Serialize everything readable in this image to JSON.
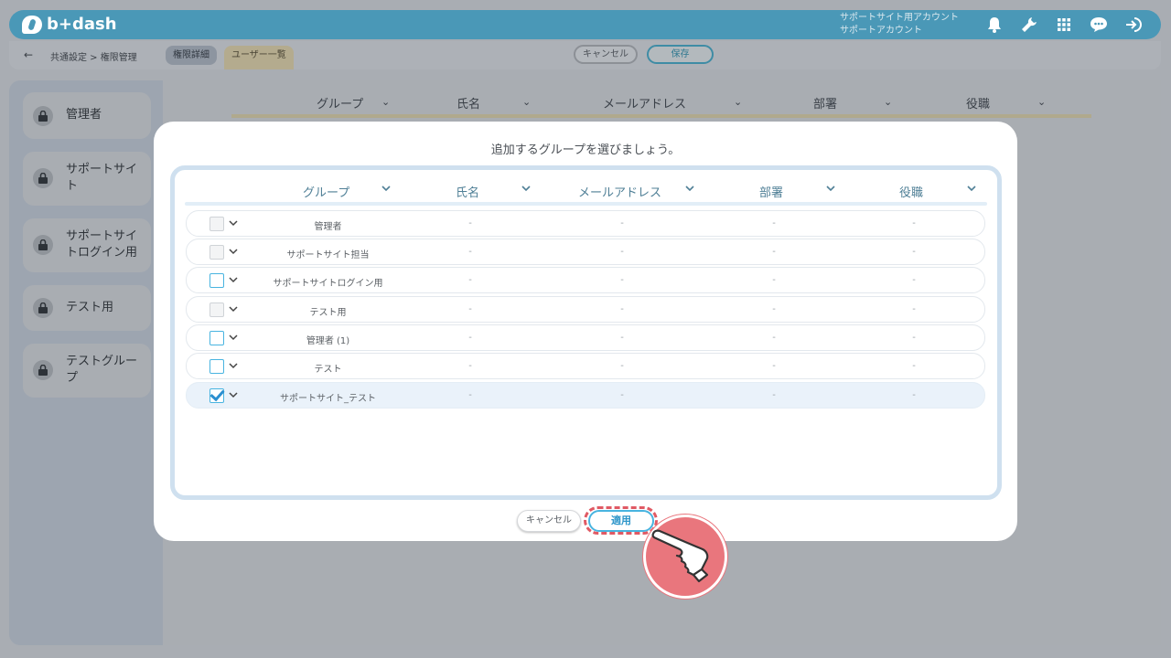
{
  "header": {
    "logo_text": "b+dash",
    "account_line1": "サポートサイト用アカウント",
    "account_line2": "サポートアカウント",
    "icons": [
      "bell-icon",
      "wrench-icon",
      "grid-icon",
      "chat-icon",
      "logout-icon"
    ]
  },
  "subheader": {
    "back_icon": "back-arrow-icon",
    "breadcrumb": "共通設定 > 権限管理",
    "tab_detail": "権限詳細",
    "tab_users": "ユーザー一覧",
    "cancel_label": "キャンセル",
    "save_label": "保存"
  },
  "sidebar": {
    "items": [
      {
        "label": "管理者"
      },
      {
        "label": "サポートサイト"
      },
      {
        "label": "サポートサイトログイン用"
      },
      {
        "label": "テスト用"
      },
      {
        "label": "テストグループ"
      }
    ]
  },
  "background_table": {
    "columns": [
      "グループ",
      "氏名",
      "メールアドレス",
      "部署",
      "役職"
    ]
  },
  "modal": {
    "title": "追加するグループを選びましょう。",
    "columns": [
      "グループ",
      "氏名",
      "メールアドレス",
      "部署",
      "役職"
    ],
    "rows": [
      {
        "group": "管理者",
        "name": "-",
        "email": "-",
        "dept": "-",
        "role": "-",
        "state": "disabled"
      },
      {
        "group": "サポートサイト担当",
        "name": "-",
        "email": "-",
        "dept": "-",
        "role": "-",
        "state": "disabled"
      },
      {
        "group": "サポートサイトログイン用",
        "name": "-",
        "email": "-",
        "dept": "-",
        "role": "-",
        "state": "unchecked"
      },
      {
        "group": "テスト用",
        "name": "-",
        "email": "-",
        "dept": "-",
        "role": "-",
        "state": "disabled"
      },
      {
        "group": "管理者 (1)",
        "name": "-",
        "email": "-",
        "dept": "-",
        "role": "-",
        "state": "unchecked"
      },
      {
        "group": "テスト",
        "name": "-",
        "email": "-",
        "dept": "-",
        "role": "-",
        "state": "unchecked"
      },
      {
        "group": "サポートサイト_テスト",
        "name": "-",
        "email": "-",
        "dept": "-",
        "role": "-",
        "state": "checked"
      }
    ],
    "cancel_label": "キャンセル",
    "apply_label": "適用"
  },
  "colors": {
    "brand": "#4a98b7",
    "accent_blue": "#48b4e0",
    "highlight_red": "#e05a64"
  },
  "pointer_icon": "hand-pointer-icon"
}
